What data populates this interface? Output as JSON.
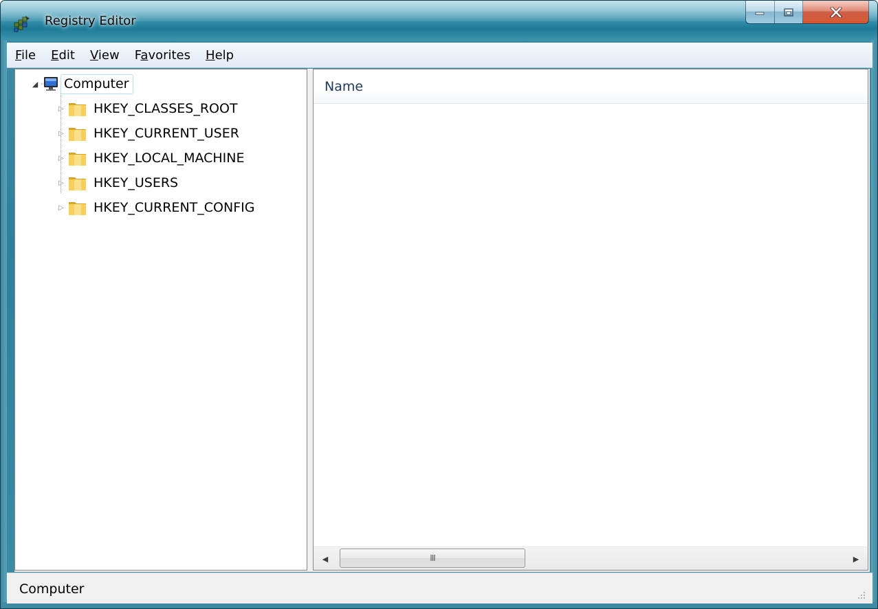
{
  "window": {
    "title": "Registry Editor",
    "accent_color": "#2f8aa6",
    "close_color": "#c2391d"
  },
  "menu": {
    "items": [
      {
        "mnemonic": "F",
        "rest": "ile"
      },
      {
        "mnemonic": "E",
        "rest": "dit"
      },
      {
        "mnemonic": "V",
        "rest": "iew"
      },
      {
        "pre": "F",
        "mnemonic": "a",
        "rest": "vorites"
      },
      {
        "mnemonic": "H",
        "rest": "elp"
      }
    ]
  },
  "tree": {
    "root": {
      "label": "Computer",
      "icon": "computer-icon",
      "expanded": true
    },
    "children": [
      {
        "label": "HKEY_CLASSES_ROOT",
        "icon": "folder-icon"
      },
      {
        "label": "HKEY_CURRENT_USER",
        "icon": "folder-icon"
      },
      {
        "label": "HKEY_LOCAL_MACHINE",
        "icon": "folder-icon"
      },
      {
        "label": "HKEY_USERS",
        "icon": "folder-icon"
      },
      {
        "label": "HKEY_CURRENT_CONFIG",
        "icon": "folder-icon"
      }
    ]
  },
  "list": {
    "columns": [
      "Name"
    ],
    "scroll_grip": "III"
  },
  "status": {
    "text": "Computer"
  }
}
